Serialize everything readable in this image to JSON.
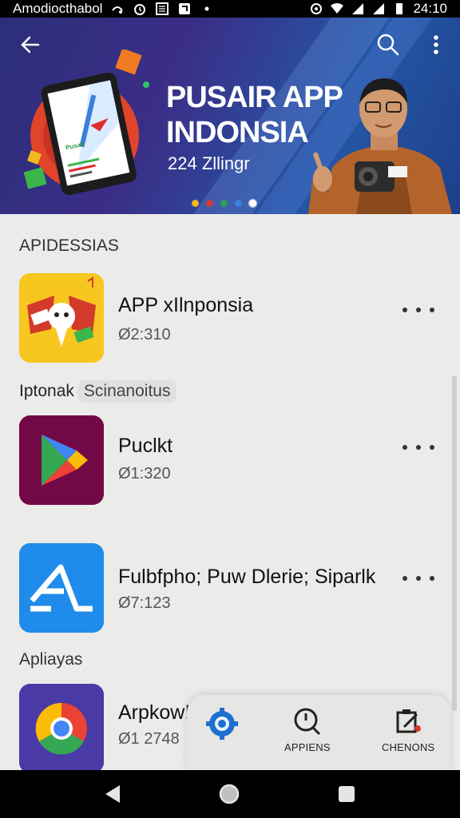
{
  "status_bar": {
    "left_text": "Amodiocthabol",
    "time": "24:10",
    "icons": [
      "notification-icon",
      "alarm-icon",
      "gallery-icon",
      "app-icon",
      "dot-icon",
      "sync-icon",
      "wifi-icon",
      "signal-icon",
      "signal-icon",
      "battery-icon"
    ]
  },
  "banner": {
    "title_line1": "PUSAIR APP",
    "title_line2": "INDONSIA",
    "subtitle": "224 Zllingr",
    "tablet_caption": "Pusair",
    "dot_colors": [
      "#f2b91c",
      "#d23a3a",
      "#2f9e55",
      "#3b7fd9",
      "#ffffff"
    ],
    "active_dot": 4
  },
  "sections": {
    "first": "APIDESSIAS",
    "second_label": "Iptonak",
    "second_chip": "Scinanoitus",
    "third": "Apliayas"
  },
  "apps": [
    {
      "name": "APP xIlnponsia",
      "meta": "Ø2:310",
      "icon": "app-xlnponsia-icon"
    },
    {
      "name": "Puclkt",
      "meta": "Ø1:320",
      "icon": "play-store-icon"
    },
    {
      "name": "Fulbfpho; Puw Dlerie; Siparlk",
      "meta": "Ø7:123",
      "icon": "app-store-icon"
    },
    {
      "name": "Arpkow!",
      "meta": "Ø1 2748",
      "icon": "chrome-icon"
    }
  ],
  "bottom_card": {
    "items": [
      {
        "label": "",
        "icon": "settings-gear-icon"
      },
      {
        "label": "APPIENS",
        "icon": "clock-search-icon"
      },
      {
        "label": "CHENONS",
        "icon": "clipboard-edit-icon"
      }
    ]
  },
  "colors": {
    "banner_start": "#2b2f7a",
    "banner_end": "#2457a6",
    "background": "#ebebea",
    "accent_blue": "#1e88e5"
  }
}
